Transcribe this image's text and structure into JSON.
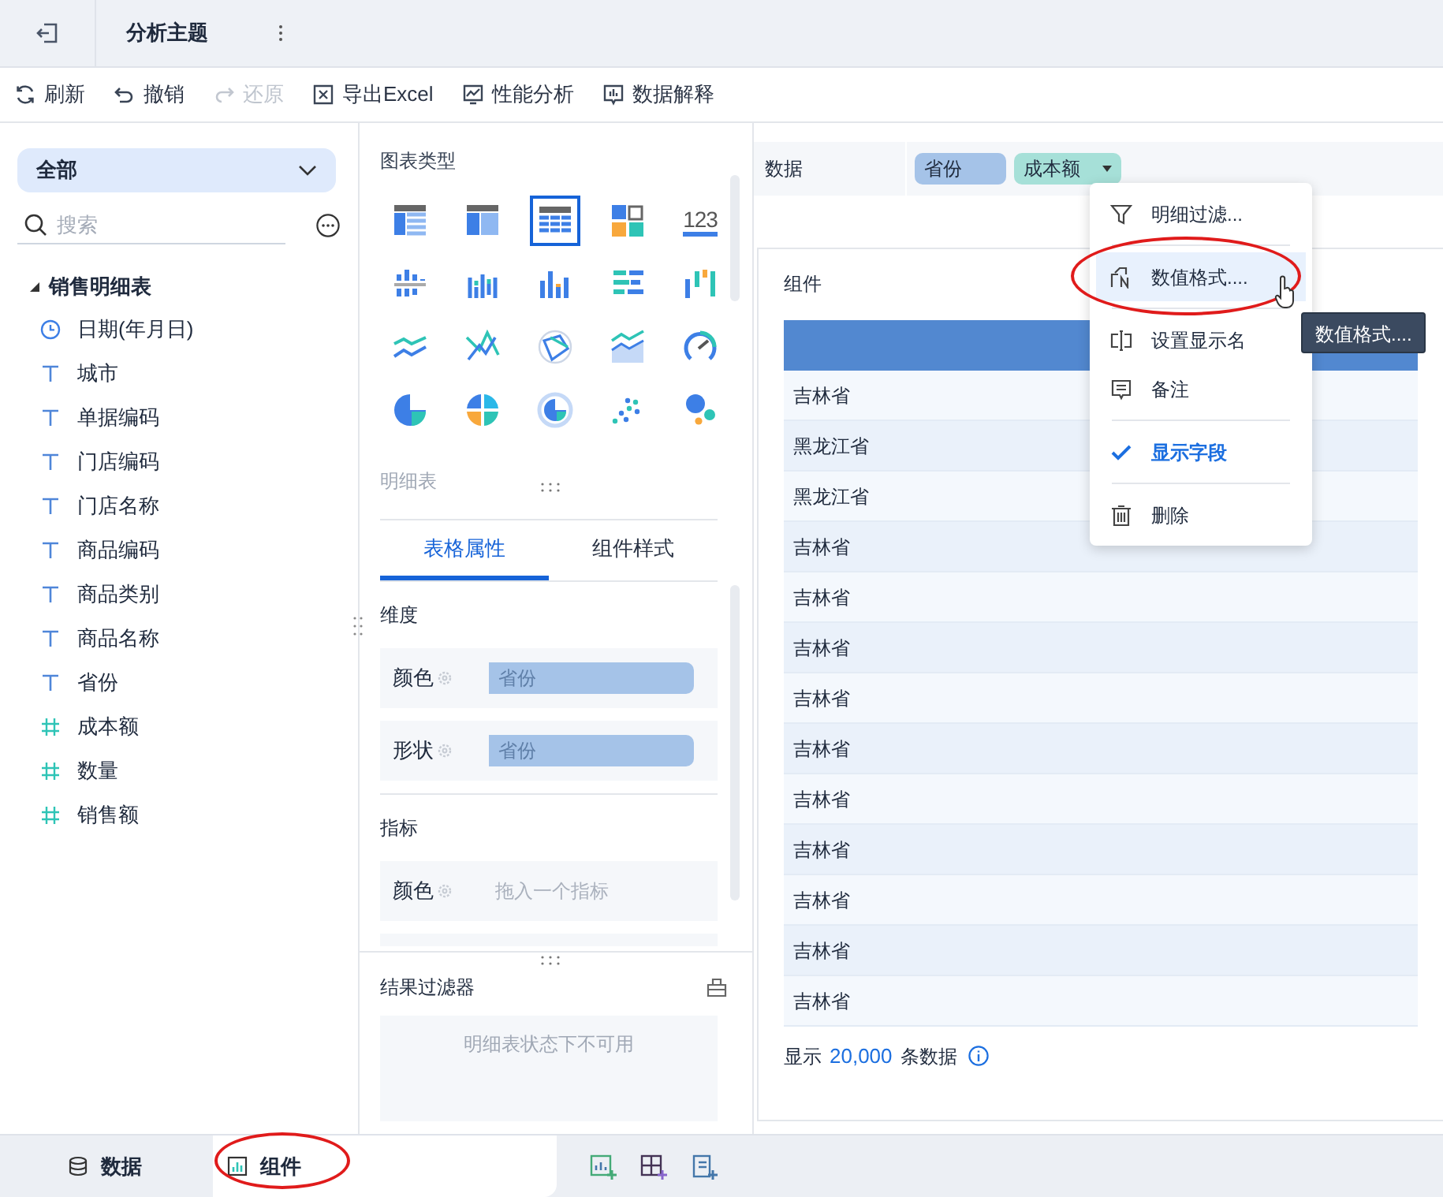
{
  "header": {
    "title": "分析主题"
  },
  "toolbar": [
    {
      "kind": "refresh",
      "label": "刷新",
      "disabled": false
    },
    {
      "kind": "undo",
      "label": "撤销",
      "disabled": false
    },
    {
      "kind": "redo",
      "label": "还原",
      "disabled": true
    },
    {
      "kind": "export",
      "label": "导出Excel",
      "disabled": false
    },
    {
      "kind": "performance",
      "label": "性能分析",
      "disabled": false
    },
    {
      "kind": "explain",
      "label": "数据解释",
      "disabled": false
    }
  ],
  "sidebar": {
    "scope": "全部",
    "search_placeholder": "搜索",
    "tree": [
      {
        "label": "销售明细表",
        "expanded": true,
        "children": [
          {
            "kind": "date",
            "label": "日期(年月日)"
          },
          {
            "kind": "text",
            "label": "城市"
          },
          {
            "kind": "text",
            "label": "单据编码"
          },
          {
            "kind": "text",
            "label": "门店编码"
          },
          {
            "kind": "text",
            "label": "门店名称"
          },
          {
            "kind": "text",
            "label": "商品编码"
          },
          {
            "kind": "text",
            "label": "商品类别"
          },
          {
            "kind": "text",
            "label": "商品名称"
          },
          {
            "kind": "text",
            "label": "省份"
          },
          {
            "kind": "number",
            "label": "成本额"
          },
          {
            "kind": "number",
            "label": "数量"
          },
          {
            "kind": "number",
            "label": "销售额"
          }
        ]
      }
    ]
  },
  "chart_panel": {
    "title": "图表类型",
    "chart_types": [
      {
        "kind": "table",
        "selected": false
      },
      {
        "kind": "crosstab",
        "selected": false
      },
      {
        "kind": "detail",
        "selected": true
      },
      {
        "kind": "blocks",
        "selected": false
      },
      {
        "kind": "number",
        "label": "123",
        "selected": false
      },
      {
        "kind": "range-bar",
        "selected": false
      },
      {
        "kind": "grouped-bar",
        "selected": false
      },
      {
        "kind": "bar",
        "selected": false
      },
      {
        "kind": "stacked-bar",
        "selected": false
      },
      {
        "kind": "waterfall",
        "selected": false
      },
      {
        "kind": "line",
        "selected": false
      },
      {
        "kind": "cross-line",
        "selected": false
      },
      {
        "kind": "radar",
        "selected": false
      },
      {
        "kind": "area",
        "selected": false
      },
      {
        "kind": "gauge",
        "selected": false
      },
      {
        "kind": "pie",
        "selected": false
      },
      {
        "kind": "multi-pie",
        "selected": false
      },
      {
        "kind": "ring",
        "selected": false
      },
      {
        "kind": "scatter",
        "selected": false
      },
      {
        "kind": "bubble",
        "selected": false
      }
    ],
    "selected_type_name": "明细表",
    "tabs": [
      {
        "label": "表格属性",
        "selected": true
      },
      {
        "label": "组件样式",
        "selected": false
      }
    ],
    "sections": [
      {
        "title": "维度",
        "slots": [
          {
            "label": "颜色",
            "value": "省份"
          },
          {
            "label": "形状",
            "value": "省份"
          }
        ]
      },
      {
        "title": "指标",
        "slots": [
          {
            "label": "颜色",
            "placeholder": "拖入一个指标"
          }
        ]
      }
    ],
    "filter": {
      "title": "结果过滤器",
      "message": "明细表状态下不可用"
    }
  },
  "data_bar": {
    "label": "数据",
    "fields": [
      {
        "label": "省份",
        "kind": "dimension",
        "menu": false
      },
      {
        "label": "成本额",
        "kind": "measure",
        "menu": true
      }
    ]
  },
  "component": {
    "title": "组件",
    "rows": [
      "吉林省",
      "黑龙江省",
      "黑龙江省",
      "吉林省",
      "吉林省",
      "吉林省",
      "吉林省",
      "吉林省",
      "吉林省",
      "吉林省",
      "吉林省",
      "吉林省",
      "吉林省"
    ],
    "footer": {
      "prefix": "显示",
      "count": "20,000",
      "suffix": "条数据"
    }
  },
  "context_menu": {
    "items": [
      {
        "kind": "filter",
        "label": "明细过滤...",
        "highlighted": false,
        "circled": false
      },
      {
        "kind": "format",
        "label": "数值格式....",
        "highlighted": true,
        "circled": true
      },
      {
        "kind": "rename",
        "label": "设置显示名",
        "highlighted": false,
        "circled": false
      },
      {
        "kind": "note",
        "label": "备注",
        "highlighted": false,
        "circled": false
      },
      {
        "kind": "check",
        "label": "显示字段",
        "checked": true,
        "highlighted": false,
        "circled": false
      },
      {
        "kind": "delete",
        "label": "删除",
        "highlighted": false,
        "circled": false
      }
    ],
    "tooltip": "数值格式...."
  },
  "bottom_tabs": [
    {
      "kind": "data",
      "label": "数据",
      "selected": false,
      "circled": false
    },
    {
      "kind": "component",
      "label": "组件",
      "selected": true,
      "circled": true
    }
  ]
}
